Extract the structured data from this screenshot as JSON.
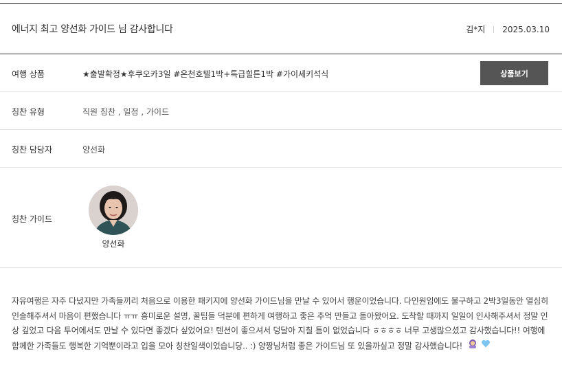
{
  "review": {
    "title": "에너지 최고 양선화 가이드 님 감사합니다",
    "author": "김*지",
    "date": "2025.03.10",
    "body": "자유여행은 자주 다녔지만 가족들끼리 처음으로 이용한 패키지에 양선화 가이드님을 만날 수 있어서 행운이었습니다. 다인원임에도 불구하고 2박3일동안 열심히 인솔해주셔서 마음이 편했습니다 ㅠㅠ 흥미로운 설명, 꿀팁들 덕분에 편하게 여행하고 좋은 추억 만들고 돌아왔어요. 도착할 때까지 일일이 인사해주셔서 정말 인상 깊었고 다음 투어에서도 만날 수 있다면 좋겠다 싶었어요! 텐션이 좋으셔서 덩달아 지칠 틈이 없었습니다 ㅎㅎㅎㅎ 너무 고생많으셨고 감사했습니다!! 여행에 함께한 가족들도 행복한 기억뿐이라고 입을 모아 칭찬일색이었습니당.. :) 양짱님처럼 좋은 가이드님 또 있을까싶고 정말 감사했습니다!"
  },
  "fields": {
    "product_label": "여행 상품",
    "product_value": "★출발확정★후쿠오카3일 #온천호텔1박+특급힐튼1박 #가이세키석식",
    "product_button": "상품보기",
    "praise_type_label": "칭찬 유형",
    "praise_type_value": "직원 칭찬 , 일정 , 가이드",
    "praise_staff_label": "칭찬 담당자",
    "praise_staff_value": "양선화",
    "praise_guide_label": "칭찬 가이드",
    "guide_name": "양선화"
  },
  "icons": {
    "emoji1": "woman-emoji-icon",
    "emoji2": "blue-heart-icon"
  }
}
